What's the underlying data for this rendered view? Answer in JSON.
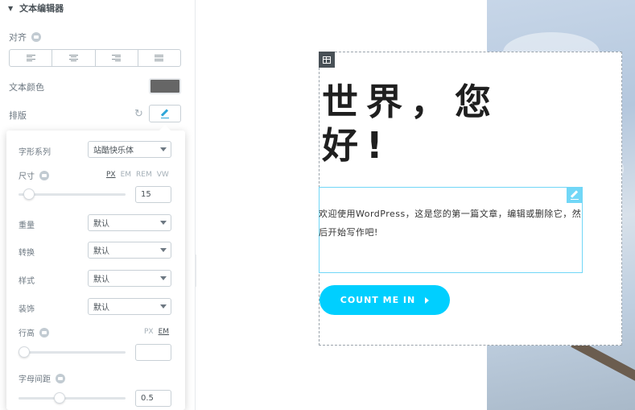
{
  "panel": {
    "section_title": "文本编辑器",
    "align_label": "对齐",
    "text_color_label": "文本颜色",
    "text_color_value": "#666666",
    "typography_label": "排版"
  },
  "typography": {
    "font_family_label": "字形系列",
    "font_family_value": "站酷快乐体",
    "size_label": "尺寸",
    "size_units": [
      "PX",
      "EM",
      "REM",
      "VW"
    ],
    "size_active_unit": "PX",
    "size_value": "15",
    "size_slider_fraction": 0.05,
    "weight_label": "重量",
    "weight_value": "默认",
    "transform_label": "转换",
    "transform_value": "默认",
    "style_label": "样式",
    "style_value": "默认",
    "decoration_label": "装饰",
    "decoration_value": "默认",
    "line_height_label": "行高",
    "line_height_units": [
      "PX",
      "EM"
    ],
    "line_height_active_unit": "EM",
    "line_height_value": "",
    "line_height_slider_fraction": 0.0,
    "letter_spacing_label": "字母间距",
    "letter_spacing_value": "0.5",
    "letter_spacing_slider_fraction": 0.37
  },
  "canvas": {
    "heading": "世界，您好!",
    "body_text": "欢迎使用WordPress，这是您的第一篇文章，编辑或删除它，然后开始写作吧!",
    "cta_label": "COUNT ME IN",
    "accent_color": "#00cfff"
  }
}
